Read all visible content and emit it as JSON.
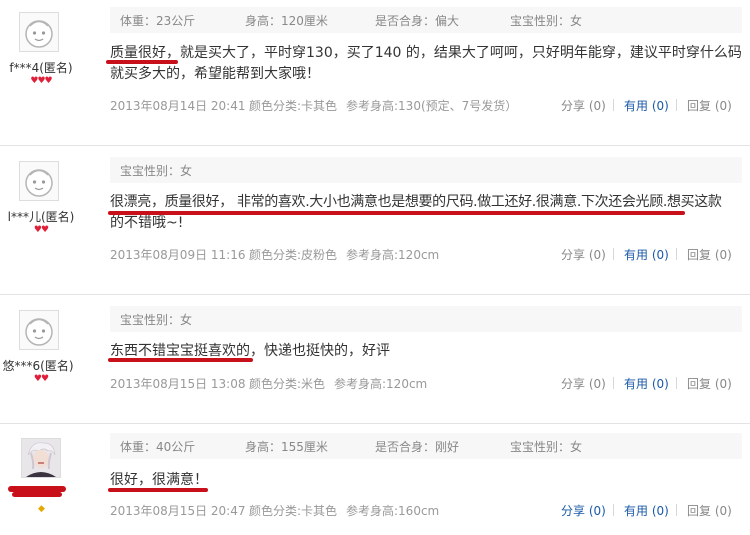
{
  "reviews": [
    {
      "user": "f***4(匿名)",
      "info": [
        "体重：23公斤",
        "身高：120厘米",
        "是否合身：偏大",
        "宝宝性别：女"
      ],
      "content_line1": "质量很好，就是买大了，平时穿130，买了140 的，结果大了呵呵，只好明年能穿，建议平时穿什么码",
      "content_line2": "就买多大的，希望能帮到大家哦！",
      "time": "2013年08月14日 20:41",
      "color": "颜色分类:卡其色",
      "height_ref": "参考身高:130(预定、7号发货）",
      "share": "分享 (0)",
      "useful": "有用 (0)",
      "reply": "回复 (0)"
    },
    {
      "user": "l***儿(匿名)",
      "info": [
        "宝宝性别：女"
      ],
      "content_line1": "很漂亮，质量很好， 非常的喜欢.大小也满意也是想要的尺码.做工还好.很满意.下次还会光顾.想买这款",
      "content_line2": "的不错哦~!",
      "time": "2013年08月09日 11:16",
      "color": "颜色分类:皮粉色",
      "height_ref": "参考身高:120cm",
      "share": "分享 (0)",
      "useful": "有用 (0)",
      "reply": "回复 (0)"
    },
    {
      "user": "悠***6(匿名)",
      "info": [
        "宝宝性别：女"
      ],
      "content_line1": "东西不错宝宝挺喜欢的，快递也挺快的，好评",
      "content_line2": "",
      "time": "2013年08月15日 13:08",
      "color": "颜色分类:米色",
      "height_ref": "参考身高:120cm",
      "share": "分享 (0)",
      "useful": "有用 (0)",
      "reply": "回复 (0)"
    },
    {
      "user": "",
      "info": [
        "体重：40公斤",
        "身高：155厘米",
        "是否合身：刚好",
        "宝宝性别：女"
      ],
      "content_line1": "很好，很满意！",
      "content_line2": "",
      "time": "2013年08月15日 20:47",
      "color": "颜色分类:卡其色",
      "height_ref": "参考身高:160cm",
      "share": "分享 (0)",
      "useful": "有用 (0)",
      "reply": "回复 (0)"
    }
  ],
  "colors": {
    "annotation": "#c8101a",
    "link_blue": "#1a5aa8",
    "badge_red": "#e0203a"
  }
}
